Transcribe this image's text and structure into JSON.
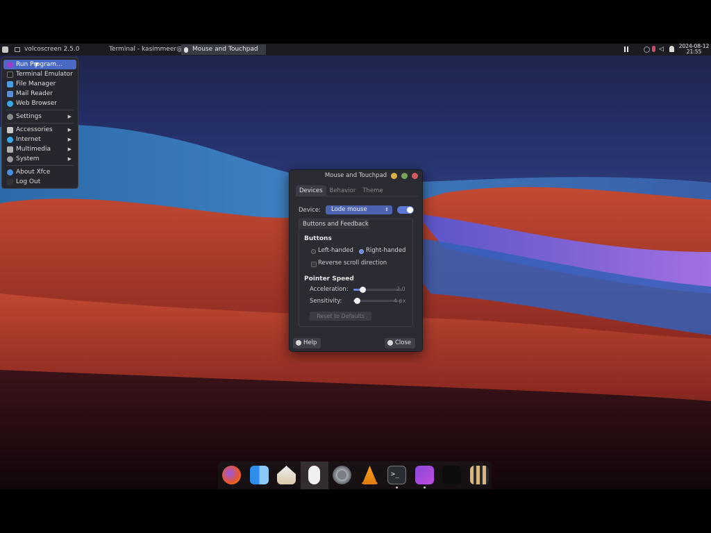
{
  "panel": {
    "app_button": "volcoscreen 2.5.0",
    "tasks": [
      {
        "label": "Terminal - kasimmeer@l..."
      },
      {
        "label": "Mouse and Touchpad"
      }
    ],
    "date": "2024-08-12",
    "time": "21:55"
  },
  "app_menu": {
    "items": [
      {
        "label": "Run Program...",
        "icon": "run-icon",
        "selected": true
      },
      {
        "label": "Terminal Emulator",
        "icon": "terminal-icon"
      },
      {
        "label": "File Manager",
        "icon": "file-manager-icon"
      },
      {
        "label": "Mail Reader",
        "icon": "mail-icon"
      },
      {
        "label": "Web Browser",
        "icon": "web-browser-icon"
      },
      {
        "label": "Settings",
        "icon": "settings-icon",
        "submenu": true
      },
      {
        "label": "Accessories",
        "icon": "accessories-icon",
        "submenu": true
      },
      {
        "label": "Internet",
        "icon": "internet-icon",
        "submenu": true
      },
      {
        "label": "Multimedia",
        "icon": "multimedia-icon",
        "submenu": true
      },
      {
        "label": "System",
        "icon": "system-icon",
        "submenu": true
      },
      {
        "label": "About Xfce",
        "icon": "about-icon"
      },
      {
        "label": "Log Out",
        "icon": "logout-icon"
      }
    ]
  },
  "dialog": {
    "title": "Mouse and Touchpad",
    "tabs": [
      "Devices",
      "Behavior",
      "Theme"
    ],
    "device_label": "Device:",
    "device_value": "Lode mouse",
    "device_enabled": true,
    "subtab": "Buttons and Feedback",
    "buttons_heading": "Buttons",
    "left_handed": "Left-handed",
    "right_handed": "Right-handed",
    "handedness": "right",
    "reverse_scroll": "Reverse scroll direction",
    "reverse_scroll_checked": false,
    "pointer_heading": "Pointer Speed",
    "acceleration_label": "Acceleration:",
    "acceleration_value": "2.0",
    "sensitivity_label": "Sensitivity:",
    "sensitivity_value": "4 px",
    "reset_button": "Reset to Defaults",
    "help_button": "Help",
    "close_button": "Close"
  },
  "dock": {
    "apps": [
      "firefox-icon",
      "finder-icon",
      "home-folder-icon",
      "mouse-settings-icon",
      "system-settings-icon",
      "vlc-icon",
      "terminal-icon",
      "screen-recorder-icon",
      "blank-window-icon",
      "app-grid-icon"
    ]
  },
  "colors": {
    "accent": "#4a69c4",
    "panel": "#1b1c22"
  }
}
